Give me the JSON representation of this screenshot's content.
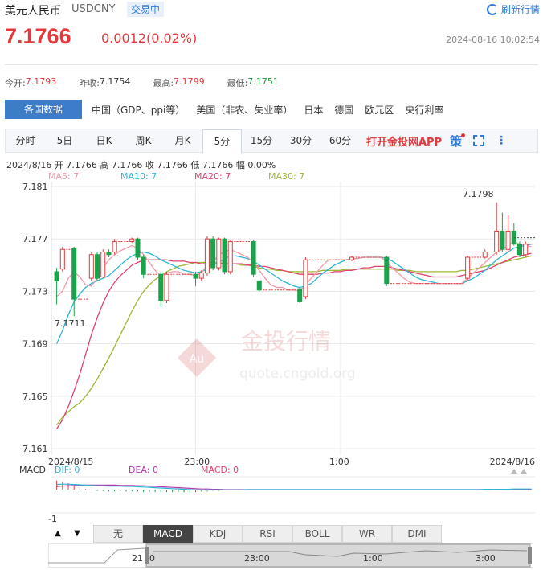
{
  "header": {
    "name": "美元人民币",
    "code": "USDCNY",
    "status": "交易中",
    "refresh_label": "刷新行情",
    "price": "7.1766",
    "change": "0.0012(0.02%)",
    "time": "2024-08-16 10:02:54"
  },
  "stats": [
    {
      "label": "今开:",
      "value": "7.1793",
      "color": "red"
    },
    {
      "label": "昨收:",
      "value": "7.1754",
      "color": "plain"
    },
    {
      "label": "最高:",
      "value": "7.1799",
      "color": "red"
    },
    {
      "label": "最低:",
      "value": "7.1751",
      "color": "green"
    }
  ],
  "category_tabs": [
    "各国数据",
    "中国（GDP、ppi等）",
    "美国（非农、失业率）",
    "日本",
    "德国",
    "欧元区",
    "央行利率"
  ],
  "period_tabs": [
    "分时",
    "5日",
    "日K",
    "周K",
    "月K",
    "5分",
    "15分",
    "30分",
    "60分"
  ],
  "active_period": "5分",
  "app_promo": "打开金投网APP",
  "ce_label": "策",
  "ohlc_line": "2024/8/16  开 7.1766  高 7.1766  收 7.1766  低 7.1766  幅 0.00%",
  "watermark": {
    "brand": "金投行情",
    "url": "quote.cngold.org",
    "logo": "Au"
  },
  "indicator_tabs": [
    "无",
    "MACD",
    "KDJ",
    "RSI",
    "BOLL",
    "WR",
    "DMI"
  ],
  "active_indicator": "MACD",
  "nav_labels": {
    "left": "21",
    "zero": "0",
    "t1": "23:00",
    "t2": "1:00",
    "t3": "3:00"
  },
  "colors": {
    "up": "#e4393c",
    "down": "#1aa34a",
    "ma5": "#f09aa6",
    "ma10": "#2bb6d6",
    "ma20": "#e0416e",
    "ma30": "#9ab832",
    "dif": "#2bb6d6",
    "dea": "#b038b0"
  },
  "chart_data": {
    "type": "candlestick",
    "ylim": [
      7.161,
      7.181
    ],
    "y_ticks": [
      "7.181",
      "7.177",
      "7.173",
      "7.169",
      "7.165",
      "7.161"
    ],
    "x_ticks": [
      "2024/8/15",
      "23:00",
      "1:00",
      "2024/8/16"
    ],
    "annotations": {
      "max": "7.1798",
      "min": "7.1711"
    },
    "legend": [
      {
        "name": "MA5: 7",
        "key": "ma5"
      },
      {
        "name": "MA10: 7",
        "key": "ma10"
      },
      {
        "name": "MA20: 7",
        "key": "ma20"
      },
      {
        "name": "MA30: 7",
        "key": "ma30"
      }
    ],
    "candles": [
      {
        "o": 7.1745,
        "c": 7.1738,
        "h": 7.1748,
        "l": 7.172
      },
      {
        "o": 7.1747,
        "c": 7.1762,
        "h": 7.1764,
        "l": 7.1745
      },
      {
        "o": 7.1762,
        "c": 7.1762,
        "h": 7.1762,
        "l": 7.1762
      },
      {
        "o": 7.1763,
        "c": 7.1724,
        "h": 7.1764,
        "l": 7.1711
      },
      {
        "o": 7.1724,
        "c": 7.1724,
        "h": 7.1724,
        "l": 7.1724
      },
      {
        "o": 7.1724,
        "c": 7.1724,
        "h": 7.1724,
        "l": 7.1724
      },
      {
        "o": 7.174,
        "c": 7.1758,
        "h": 7.176,
        "l": 7.1738
      },
      {
        "o": 7.1758,
        "c": 7.174,
        "h": 7.176,
        "l": 7.1738
      },
      {
        "o": 7.1741,
        "c": 7.176,
        "h": 7.1762,
        "l": 7.174
      },
      {
        "o": 7.176,
        "c": 7.1758,
        "h": 7.1762,
        "l": 7.1756
      },
      {
        "o": 7.176,
        "c": 7.1768,
        "h": 7.177,
        "l": 7.1758
      },
      {
        "o": 7.1768,
        "c": 7.1768,
        "h": 7.1768,
        "l": 7.1768
      },
      {
        "o": 7.1768,
        "c": 7.1768,
        "h": 7.1768,
        "l": 7.1768
      },
      {
        "o": 7.1768,
        "c": 7.177,
        "h": 7.1771,
        "l": 7.1767
      },
      {
        "o": 7.177,
        "c": 7.1756,
        "h": 7.1771,
        "l": 7.1754
      },
      {
        "o": 7.1756,
        "c": 7.1743,
        "h": 7.1758,
        "l": 7.174
      },
      {
        "o": 7.1743,
        "c": 7.1743,
        "h": 7.1743,
        "l": 7.1743
      },
      {
        "o": 7.1743,
        "c": 7.1743,
        "h": 7.1743,
        "l": 7.1743
      },
      {
        "o": 7.1743,
        "c": 7.1723,
        "h": 7.1745,
        "l": 7.1718
      },
      {
        "o": 7.1723,
        "c": 7.1743,
        "h": 7.1745,
        "l": 7.1721
      },
      {
        "o": 7.1743,
        "c": 7.1743,
        "h": 7.1743,
        "l": 7.1743
      },
      {
        "o": 7.1743,
        "c": 7.1743,
        "h": 7.1743,
        "l": 7.1743
      },
      {
        "o": 7.1743,
        "c": 7.1743,
        "h": 7.1743,
        "l": 7.1743
      },
      {
        "o": 7.1743,
        "c": 7.1743,
        "h": 7.1743,
        "l": 7.1743
      },
      {
        "o": 7.1743,
        "c": 7.174,
        "h": 7.1745,
        "l": 7.1734
      },
      {
        "o": 7.174,
        "c": 7.1744,
        "h": 7.1746,
        "l": 7.1738
      },
      {
        "o": 7.1744,
        "c": 7.177,
        "h": 7.1772,
        "l": 7.1742
      },
      {
        "o": 7.177,
        "c": 7.1748,
        "h": 7.1772,
        "l": 7.1746
      },
      {
        "o": 7.1748,
        "c": 7.177,
        "h": 7.1771,
        "l": 7.1746
      },
      {
        "o": 7.177,
        "c": 7.1745,
        "h": 7.1771,
        "l": 7.1743
      },
      {
        "o": 7.1745,
        "c": 7.1768,
        "h": 7.1769,
        "l": 7.1743
      },
      {
        "o": 7.1768,
        "c": 7.1768,
        "h": 7.1768,
        "l": 7.1768
      },
      {
        "o": 7.1768,
        "c": 7.1768,
        "h": 7.1768,
        "l": 7.1768
      },
      {
        "o": 7.1768,
        "c": 7.1768,
        "h": 7.1768,
        "l": 7.1768
      },
      {
        "o": 7.1768,
        "c": 7.1743,
        "h": 7.1769,
        "l": 7.1741
      },
      {
        "o": 7.1738,
        "c": 7.1731,
        "h": 7.1738,
        "l": 7.173
      },
      {
        "o": 7.1731,
        "c": 7.1731,
        "h": 7.1731,
        "l": 7.1731
      },
      {
        "o": 7.1731,
        "c": 7.1731,
        "h": 7.1731,
        "l": 7.1731
      },
      {
        "o": 7.1731,
        "c": 7.1731,
        "h": 7.1731,
        "l": 7.1731
      },
      {
        "o": 7.1731,
        "c": 7.1731,
        "h": 7.1731,
        "l": 7.1731
      },
      {
        "o": 7.1731,
        "c": 7.1731,
        "h": 7.1731,
        "l": 7.1731
      },
      {
        "o": 7.1731,
        "c": 7.1731,
        "h": 7.1731,
        "l": 7.1731
      },
      {
        "o": 7.1732,
        "c": 7.1722,
        "h": 7.1733,
        "l": 7.1721
      },
      {
        "o": 7.1726,
        "c": 7.1754,
        "h": 7.1756,
        "l": 7.1724
      },
      {
        "o": 7.1754,
        "c": 7.1754,
        "h": 7.1754,
        "l": 7.1754
      },
      {
        "o": 7.1754,
        "c": 7.1754,
        "h": 7.1754,
        "l": 7.1754
      },
      {
        "o": 7.1754,
        "c": 7.1754,
        "h": 7.1754,
        "l": 7.1754
      },
      {
        "o": 7.1754,
        "c": 7.1754,
        "h": 7.1754,
        "l": 7.1754
      },
      {
        "o": 7.1754,
        "c": 7.1754,
        "h": 7.1754,
        "l": 7.1754
      },
      {
        "o": 7.1754,
        "c": 7.1754,
        "h": 7.1754,
        "l": 7.1754
      },
      {
        "o": 7.1754,
        "c": 7.1754,
        "h": 7.1754,
        "l": 7.1754
      },
      {
        "o": 7.1754,
        "c": 7.1756,
        "h": 7.1757,
        "l": 7.1753
      },
      {
        "o": 7.1756,
        "c": 7.1756,
        "h": 7.1756,
        "l": 7.1756
      },
      {
        "o": 7.1756,
        "c": 7.1756,
        "h": 7.1756,
        "l": 7.1756
      },
      {
        "o": 7.1756,
        "c": 7.1756,
        "h": 7.1756,
        "l": 7.1756
      },
      {
        "o": 7.1756,
        "c": 7.1756,
        "h": 7.1756,
        "l": 7.1756
      },
      {
        "o": 7.1756,
        "c": 7.1756,
        "h": 7.1756,
        "l": 7.1756
      },
      {
        "o": 7.1756,
        "c": 7.1736,
        "h": 7.1757,
        "l": 7.1734
      },
      {
        "o": 7.1736,
        "c": 7.1736,
        "h": 7.1736,
        "l": 7.1736
      },
      {
        "o": 7.1736,
        "c": 7.1736,
        "h": 7.1736,
        "l": 7.1736
      },
      {
        "o": 7.1736,
        "c": 7.1736,
        "h": 7.1736,
        "l": 7.1736
      },
      {
        "o": 7.1736,
        "c": 7.1736,
        "h": 7.1736,
        "l": 7.1736
      },
      {
        "o": 7.1736,
        "c": 7.1736,
        "h": 7.1736,
        "l": 7.1736
      },
      {
        "o": 7.1736,
        "c": 7.1736,
        "h": 7.1736,
        "l": 7.1736
      },
      {
        "o": 7.1736,
        "c": 7.1736,
        "h": 7.1736,
        "l": 7.1736
      },
      {
        "o": 7.1736,
        "c": 7.1736,
        "h": 7.1736,
        "l": 7.1736
      },
      {
        "o": 7.1736,
        "c": 7.1736,
        "h": 7.1736,
        "l": 7.1736
      },
      {
        "o": 7.1736,
        "c": 7.1736,
        "h": 7.1736,
        "l": 7.1736
      },
      {
        "o": 7.1736,
        "c": 7.1736,
        "h": 7.1736,
        "l": 7.1736
      },
      {
        "o": 7.1736,
        "c": 7.1736,
        "h": 7.1736,
        "l": 7.1736
      },
      {
        "o": 7.1736,
        "c": 7.1736,
        "h": 7.1736,
        "l": 7.1736
      },
      {
        "o": 7.174,
        "c": 7.1756,
        "h": 7.1757,
        "l": 7.1738
      },
      {
        "o": 7.1756,
        "c": 7.1756,
        "h": 7.1756,
        "l": 7.1756
      },
      {
        "o": 7.1756,
        "c": 7.1756,
        "h": 7.1756,
        "l": 7.1756
      },
      {
        "o": 7.1756,
        "c": 7.176,
        "h": 7.1762,
        "l": 7.1755
      },
      {
        "o": 7.176,
        "c": 7.176,
        "h": 7.176,
        "l": 7.176
      },
      {
        "o": 7.176,
        "c": 7.1776,
        "h": 7.1798,
        "l": 7.1758
      },
      {
        "o": 7.1776,
        "c": 7.1762,
        "h": 7.179,
        "l": 7.176
      },
      {
        "o": 7.1762,
        "c": 7.1776,
        "h": 7.1788,
        "l": 7.176
      },
      {
        "o": 7.1776,
        "c": 7.1766,
        "h": 7.1782,
        "l": 7.1765
      },
      {
        "o": 7.1766,
        "c": 7.1758,
        "h": 7.1768,
        "l": 7.1756
      },
      {
        "o": 7.1758,
        "c": 7.1766,
        "h": 7.1768,
        "l": 7.1756
      },
      {
        "o": 7.1766,
        "c": 7.1766,
        "h": 7.1766,
        "l": 7.1766
      }
    ],
    "ma": {
      "ma5": [
        7.1726,
        7.173,
        7.174,
        7.1745,
        7.1741,
        7.1735,
        7.1734,
        7.174,
        7.1748,
        7.1754,
        7.1758,
        7.1761,
        7.1763,
        7.1765,
        7.1763,
        7.1758,
        7.1752,
        7.1746,
        7.1742,
        7.1744,
        7.1745,
        7.1745,
        7.1743,
        7.1743,
        7.1742,
        7.1744,
        7.175,
        7.1752,
        7.1758,
        7.176,
        7.1762,
        7.176,
        7.1758,
        7.1756,
        7.1752,
        7.1746,
        7.174,
        7.1735,
        7.1733,
        7.1733,
        7.1731,
        7.1731,
        7.173,
        7.1735,
        7.174,
        7.1745,
        7.175,
        7.1754,
        7.1754,
        7.1754,
        7.1754,
        7.1755,
        7.1755,
        7.1756,
        7.1756,
        7.1756,
        7.1756,
        7.1752,
        7.1748,
        7.1744,
        7.174,
        7.1737,
        7.1736,
        7.1736,
        7.1736,
        7.1736,
        7.1736,
        7.1736,
        7.1736,
        7.1736,
        7.1736,
        7.174,
        7.1744,
        7.1748,
        7.1752,
        7.1756,
        7.176,
        7.1762,
        7.1765,
        7.1768,
        7.1766,
        7.1765,
        7.1764
      ],
      "ma10": [
        7.169,
        7.17,
        7.1712,
        7.1722,
        7.1728,
        7.1733,
        7.1736,
        7.1738,
        7.174,
        7.1742,
        7.1746,
        7.175,
        7.1754,
        7.1757,
        7.1759,
        7.176,
        7.1759,
        7.1757,
        7.1754,
        7.1752,
        7.175,
        7.1748,
        7.1746,
        7.1745,
        7.1744,
        7.1745,
        7.1747,
        7.175,
        7.1752,
        7.1755,
        7.1757,
        7.1757,
        7.1756,
        7.1755,
        7.1753,
        7.175,
        7.1747,
        7.1744,
        7.1741,
        7.1738,
        7.1736,
        7.1734,
        7.1733,
        7.1734,
        7.1736,
        7.174,
        7.1744,
        7.1747,
        7.175,
        7.1752,
        7.1754,
        7.1755,
        7.1755,
        7.1756,
        7.1756,
        7.1756,
        7.1756,
        7.1755,
        7.1753,
        7.175,
        7.1747,
        7.1744,
        7.1741,
        7.1739,
        7.1738,
        7.1737,
        7.1736,
        7.1736,
        7.1736,
        7.1736,
        7.1736,
        7.1738,
        7.174,
        7.1743,
        7.1746,
        7.175,
        7.1754,
        7.1757,
        7.176,
        7.1763,
        7.1764,
        7.1765,
        7.1766
      ],
      "ma20": [
        7.1625,
        7.1632,
        7.1642,
        7.1654,
        7.1667,
        7.1682,
        7.1697,
        7.171,
        7.1721,
        7.173,
        7.1737,
        7.1742,
        7.1746,
        7.175,
        7.1752,
        7.1754,
        7.1754,
        7.1754,
        7.1754,
        7.1754,
        7.1753,
        7.1753,
        7.1753,
        7.1752,
        7.1752,
        7.1751,
        7.1751,
        7.1751,
        7.1751,
        7.1751,
        7.1751,
        7.1751,
        7.1751,
        7.175,
        7.175,
        7.1749,
        7.1749,
        7.1748,
        7.1747,
        7.1746,
        7.1745,
        7.1744,
        7.1743,
        7.1743,
        7.1743,
        7.1743,
        7.1744,
        7.1744,
        7.1745,
        7.1745,
        7.1746,
        7.1746,
        7.1747,
        7.1748,
        7.1748,
        7.1749,
        7.1749,
        7.1749,
        7.1748,
        7.1747,
        7.1746,
        7.1745,
        7.1744,
        7.1743,
        7.1742,
        7.1741,
        7.1741,
        7.1741,
        7.1741,
        7.1741,
        7.1742,
        7.1743,
        7.1744,
        7.1745,
        7.1746,
        7.1748,
        7.175,
        7.1752,
        7.1754,
        7.1756,
        7.1757,
        7.1758,
        7.1759
      ],
      "ma30": [
        7.1628,
        7.1634,
        7.1638,
        7.1642,
        7.1645,
        7.165,
        7.1656,
        7.1663,
        7.1671,
        7.1679,
        7.1688,
        7.1697,
        7.1706,
        7.1715,
        7.1723,
        7.173,
        7.1735,
        7.1739,
        7.1742,
        7.1745,
        7.1747,
        7.1749,
        7.175,
        7.1751,
        7.1752,
        7.1752,
        7.1752,
        7.1752,
        7.1752,
        7.1751,
        7.1751,
        7.1751,
        7.175,
        7.175,
        7.1749,
        7.1748,
        7.1747,
        7.1747,
        7.1746,
        7.1746,
        7.1745,
        7.1745,
        7.1745,
        7.1745,
        7.1745,
        7.1745,
        7.1746,
        7.1746,
        7.1746,
        7.1746,
        7.1747,
        7.1747,
        7.1747,
        7.1747,
        7.1747,
        7.1747,
        7.1747,
        7.1747,
        7.1747,
        7.1746,
        7.1746,
        7.1746,
        7.1745,
        7.1745,
        7.1745,
        7.1745,
        7.1745,
        7.1745,
        7.1745,
        7.1745,
        7.1746,
        7.1746,
        7.1747,
        7.1748,
        7.1749,
        7.175,
        7.1751,
        7.1752,
        7.1753,
        7.1754,
        7.1755,
        7.1756,
        7.1757
      ]
    },
    "macd": {
      "legend": [
        {
          "name": "DIF: 0",
          "key": "dif"
        },
        {
          "name": "DEA: 0",
          "key": "dea"
        },
        {
          "name": "MACD: 0",
          "key": "ma20"
        }
      ],
      "label": "MACD",
      "ylabel_bottom": "-1",
      "ylim": [
        -1,
        1
      ],
      "dif": [
        0.16,
        0.17,
        0.17,
        0.16,
        0.15,
        0.14,
        0.13,
        0.12,
        0.12,
        0.11,
        0.11,
        0.11,
        0.1,
        0.1,
        0.09,
        0.08,
        0.07,
        0.06,
        0.05,
        0.04,
        0.03,
        0.02,
        0.01,
        0.0,
        -0.01,
        -0.01,
        -0.01,
        -0.01,
        -0.01,
        -0.01,
        -0.01,
        -0.01,
        -0.01,
        0.0,
        0.0,
        0.0,
        0.0,
        0.0,
        0.0,
        0.0,
        0.0,
        0.0,
        0.0,
        0.0,
        0.0,
        0.0,
        0.0,
        0.0,
        0.0,
        0.0,
        0.0,
        0.0,
        0.0,
        0.0,
        0.0,
        0.0,
        0.0,
        0.0,
        0.0,
        0.0,
        0.0,
        0.0,
        0.0,
        0.0,
        0.0,
        0.0,
        0.0,
        0.0,
        0.0,
        0.0,
        0.0,
        0.0,
        0.0,
        0.0,
        0.01,
        0.01,
        0.01,
        0.01,
        0.01,
        0.02,
        0.02,
        0.02,
        0.02
      ],
      "dea": [
        0.1,
        0.11,
        0.12,
        0.13,
        0.13,
        0.14,
        0.14,
        0.14,
        0.14,
        0.14,
        0.14,
        0.13,
        0.13,
        0.13,
        0.12,
        0.12,
        0.11,
        0.1,
        0.09,
        0.08,
        0.07,
        0.06,
        0.05,
        0.04,
        0.03,
        0.02,
        0.02,
        0.01,
        0.01,
        0.0,
        0.0,
        0.0,
        0.0,
        0.0,
        0.0,
        0.0,
        0.0,
        0.0,
        0.0,
        0.0,
        0.0,
        0.0,
        0.0,
        0.0,
        0.0,
        0.0,
        0.0,
        0.0,
        0.0,
        0.0,
        0.0,
        0.0,
        0.0,
        0.0,
        0.0,
        0.0,
        0.0,
        0.0,
        0.0,
        0.0,
        0.0,
        0.0,
        0.0,
        0.0,
        0.0,
        0.0,
        0.0,
        0.0,
        0.0,
        0.0,
        0.0,
        0.0,
        0.0,
        0.0,
        0.0,
        0.01,
        0.01,
        0.01,
        0.01,
        0.01,
        0.01,
        0.01,
        0.01
      ],
      "bars": [
        0.28,
        0.24,
        0.2,
        0.12,
        0.08,
        0.02,
        -0.02,
        -0.04,
        -0.04,
        -0.06,
        -0.06,
        -0.04,
        -0.06,
        -0.06,
        -0.06,
        -0.08,
        -0.08,
        -0.08,
        -0.08,
        -0.08,
        -0.08,
        -0.08,
        -0.08,
        -0.08,
        -0.08,
        -0.06,
        -0.06,
        -0.04,
        -0.04,
        -0.02,
        -0.02,
        -0.02,
        -0.02,
        0,
        0,
        0,
        0,
        0,
        0,
        0,
        0,
        0,
        0,
        0,
        0,
        0,
        0,
        0,
        0,
        0,
        0,
        0,
        0,
        0,
        0,
        0,
        0,
        0,
        0,
        0,
        0,
        0,
        0,
        0,
        0,
        0,
        0,
        0,
        0,
        0,
        0,
        0,
        0,
        0,
        0.01,
        0.01,
        0.01,
        0.01,
        0.01,
        0.02,
        0.02,
        0.02,
        0.02
      ]
    }
  }
}
